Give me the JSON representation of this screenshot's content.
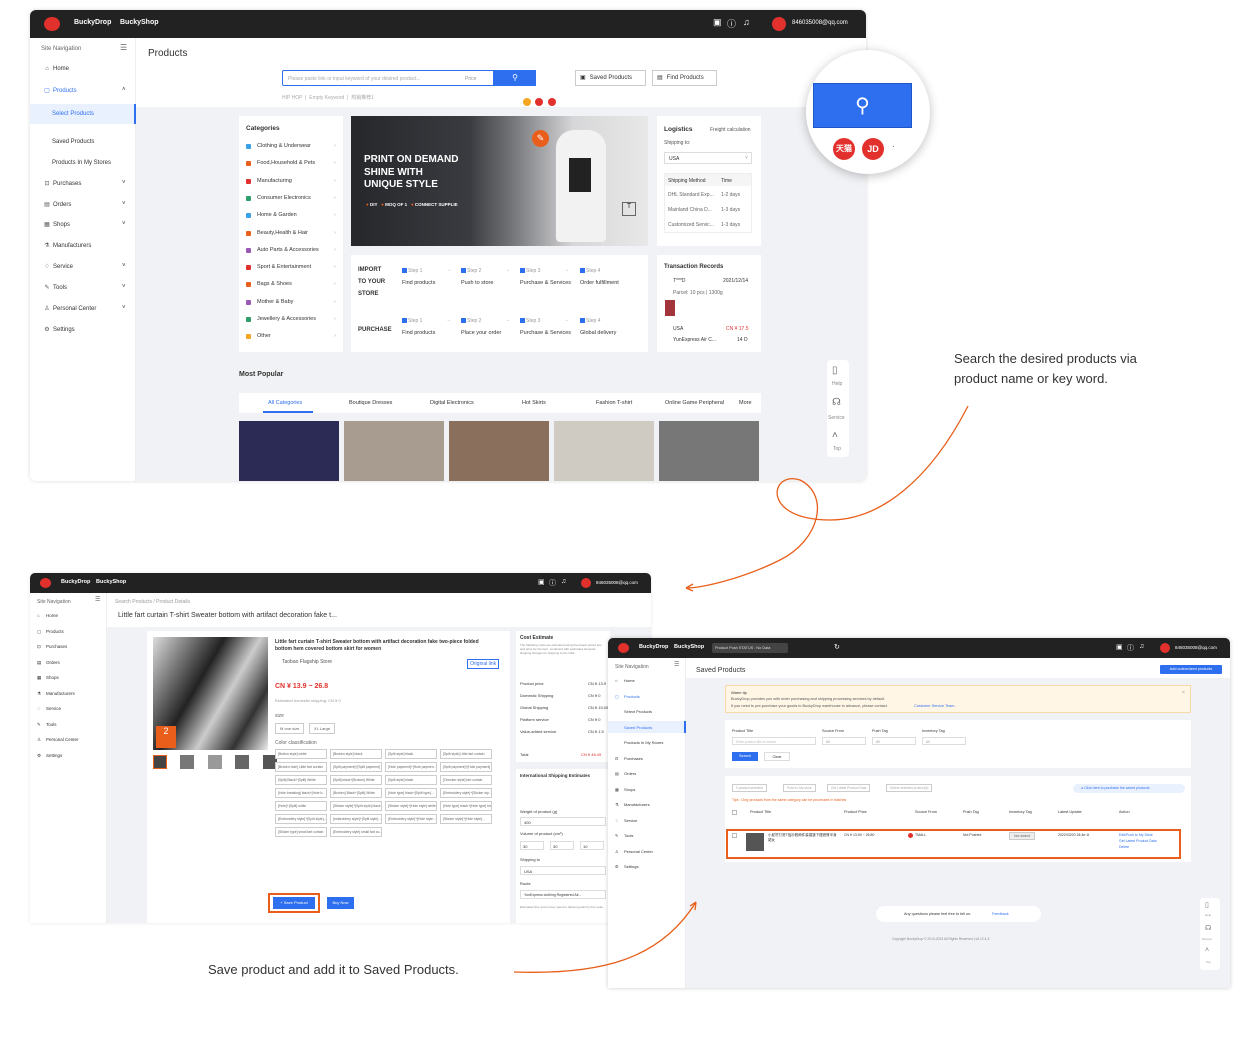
{
  "shot1": {
    "brand1": "BuckyDrop",
    "brand2": "BuckyShop",
    "email": "846035008@qq.com",
    "nav_title": "Site Navigation",
    "nav": [
      "Home",
      "Products",
      "Select Products",
      "Saved Products",
      "Products In My Stores",
      "Purchases",
      "Orders",
      "Shops",
      "Manufacturers",
      "Service",
      "Tools",
      "Personal Center",
      "Settings"
    ],
    "page_title": "Products",
    "search_placeholder": "Please paste link or input keyword of your desired product...",
    "price_label": "Price",
    "saved_btn": "Saved Products",
    "find_btn": "Find Products",
    "hot_keywords": [
      "HIP HOP",
      "Empty Keyword",
      "热销推荐1"
    ],
    "categories_title": "Categories",
    "categories": [
      "Clothing & Underwear",
      "Food,Household & Pets",
      "Manufacturing",
      "Consumer Electronics",
      "Home & Garden",
      "Beauty,Health & Hair",
      "Auto Parts & Accessories",
      "Sport & Entertainment",
      "Bags & Shoes",
      "Mother & Baby",
      "Jewellery & Accessories",
      "Other"
    ],
    "banner": {
      "line1": "PRINT ON DEMAND",
      "line2": "SHINE WITH",
      "line3": "UNIQUE STYLE",
      "tags": [
        "DIY",
        "MOQ OF 1",
        "CONNECT SUPPLIE"
      ]
    },
    "logistics": {
      "title": "Logistics",
      "freight": "Freight calculation",
      "ship_to": "Shipping to:",
      "country": "USA",
      "col1": "Shipping Method",
      "col2": "Time",
      "rows": [
        [
          "DHL Standard Exp...",
          "1-2 days"
        ],
        [
          "Mainland China D...",
          "1-3 days"
        ],
        [
          "Customized Servic...",
          "1-3 days"
        ]
      ]
    },
    "import_steps": {
      "label1": "IMPORT",
      "label2": "TO YOUR",
      "label3": "STORE",
      "steps": [
        "Step 1",
        "Step 2",
        "Step 3",
        "Step 4"
      ],
      "items": [
        "Find products",
        "Push to store",
        "Purchase & Services",
        "Order fulfillment"
      ]
    },
    "purchase_steps": {
      "label": "PURCHASE",
      "items": [
        "Find products",
        "Place your order",
        "Purchase & Services",
        "Global delivery"
      ]
    },
    "transaction": {
      "title": "Transaction Records",
      "user": "T***D",
      "date": "2021/12/14",
      "parcel": "Parcel: 10 pcs | 1300g",
      "country": "USA",
      "price": "CN ¥ 17.5",
      "carrier": "YunExpress Air C...",
      "days": "14 D"
    },
    "popular_title": "Most Popular",
    "popular_tabs": [
      "All Categories",
      "Boutique Dresses",
      "Digital Electronics",
      "Hot Skirts",
      "Fashion T-shirt",
      "Online Game Peripheral",
      "More"
    ],
    "float_items": [
      "Help",
      "Service",
      "Top"
    ],
    "zoom_badges": [
      "天猫",
      "JD"
    ]
  },
  "annotation1": "Search the desired products via product name or key word.",
  "annotation2": "Save product and add it to Saved Products.",
  "shot2": {
    "brand1": "BuckyDrop",
    "brand2": "BuckyShop",
    "email": "846035008@qq.com",
    "nav_title": "Site Navigation",
    "nav": [
      "Home",
      "Products",
      "Purchases",
      "Orders",
      "Shops",
      "Manufacturers",
      "Service",
      "Tools",
      "Personal Center",
      "Settings"
    ],
    "breadcrumb": "Search Products / Product Details",
    "page_title": "Little fart curtain T-shirt Sweater bottom with artifact decoration fake t...",
    "product_title": "Little fart curtain T-shirt Sweater bottom with artifact decoration fake two-piece folded bottom hem covered bottom skirt for women",
    "store": "Taobao Flagship Store",
    "original_link": "Original link",
    "price": "CN ¥ 13.9 ~ 26.8",
    "shipping": "Estimated domestic shipping: CN ¥ 0",
    "size_label": "size",
    "sizes": [
      "M one size",
      "XL Large"
    ],
    "color_label": "Color classification",
    "colors": [
      "[Button style] white",
      "[Broken style] black",
      "[Split style] black",
      "[Split style] Little fart curtain",
      "[Broken hole] Little fart curtain",
      "[Split payment]+[Split payment]",
      "[Hole payment]+[Hole paymen...",
      "[Split payment]+[Hole payment]",
      "[Split] Black+[Split] White",
      "[Split] black+[Broken] White",
      "[Split style] black",
      "[Checker style] fart curtain",
      "[Hole breaking] black+[Hole b...",
      "[Broken] Black+[Split] White",
      "[Hole type] black+[Split type]...",
      "[Embroidery style]+[Sticker sty...",
      "[Hole]+[Split] white",
      "[Sticker style]+[Split style] black",
      "[Sticker style]+[Hole style] white",
      "[Hole type] black+[Hole type] black",
      "[Embroidery style]+[Split style]...",
      "[embroidery style]+[Split style]...",
      "[Embroidery style]+[Hole style...",
      "[Sticker style]+[Hole style]...",
      "[Sticker type] small fart curtain",
      "[Embroidery style] small fart cu..."
    ],
    "save_btn": "Save Product",
    "buy_btn": "Buy Now",
    "cost": {
      "title": "Cost Estimate",
      "note": "The following costs are estimated using the lowest priced sku and price for the item, combined with estimated domestic shipping charges for shipping to the USA.",
      "rows": [
        [
          "Product price",
          "CN ¥ 13.9"
        ],
        [
          "Domestic Shipping",
          "CN ¥ 0"
        ],
        [
          "Global Shipping",
          "CN ¥ 15.00"
        ],
        [
          "Platform service",
          "CN ¥ 0"
        ],
        [
          "Value-added service",
          "CN ¥ 1.5"
        ]
      ],
      "total_label": "Total",
      "total": "CN ¥ 48.49"
    },
    "intl": {
      "title": "International Shipping Estimates",
      "weight_label": "Weight of product (g)",
      "weight": "400",
      "volume_label": "Volume of product (cm³)",
      "dims": [
        "30",
        "30",
        "10"
      ],
      "ship_label": "Shipping to",
      "country": "USA",
      "route_label": "Route",
      "route": "YunExpress clothing Registered Air...",
      "note": "Estimated time and money spent to deliver goods by this route."
    }
  },
  "shot3": {
    "brand1": "BuckyDrop",
    "brand2": "BuckyShop",
    "email": "846035008@qq.com",
    "push_status": "Product Push STATUS : No Data",
    "nav_title": "Site Navigation",
    "nav": [
      "Home",
      "Products",
      "Select Products",
      "Saved Products",
      "Products In My Stores",
      "Purchases",
      "Orders",
      "Shops",
      "Manufacturers",
      "Service",
      "Tools",
      "Personal Center",
      "Settings"
    ],
    "page_title": "Saved Products",
    "add_btn": "Add customized products",
    "warm_title": "Warm tip",
    "warm_text1": "BuckyDrop provides you with order purchasing and shipping processing services by default.",
    "warm_text2": "If you need to pre-purchase your goods to BuckyDrop warehouse in advance, please contact",
    "warm_link": "Customer Service Team.",
    "filters": [
      "Product Title",
      "Source From",
      "Push Tag",
      "Inventory Tag"
    ],
    "title_placeholder": "Enter product title to search",
    "all": "All",
    "search_btn": "Search",
    "clear_btn": "Clear",
    "bulk": [
      "0 product selected",
      "Push to My store",
      "Get Latest Product Data",
      "Delete selected product(s)"
    ],
    "click_here": "Click here to purchase the saved products",
    "tips": "Tips : Only products from the same category can be processed in batches",
    "cols": [
      "Product Title",
      "Product Price",
      "Source From",
      "Push Tag",
      "Inventory Tag",
      "Latest Update",
      "Action"
    ],
    "row": {
      "title": "小屁帘打底T恤衫假两件装褶皱下摆遮臀半身裙女",
      "price": "CN ¥ 13.90 ~ 26.80",
      "source": "TMALL",
      "push": "Not Pushed",
      "inventory": "Not added",
      "update": "2022/03/20 18:4e:1t",
      "actions": [
        "Edit/Push to My Store",
        "Get Latest Product Data",
        "Delete"
      ]
    },
    "feedback_q": "Any questions please feel free to tell us.",
    "feedback": "Feedback",
    "copyright": "Copyright BuckyDrop © 2013-2023 All Rights Reserved | v8.12.4-3",
    "float_items": [
      "Help",
      "Service",
      "Top"
    ]
  }
}
